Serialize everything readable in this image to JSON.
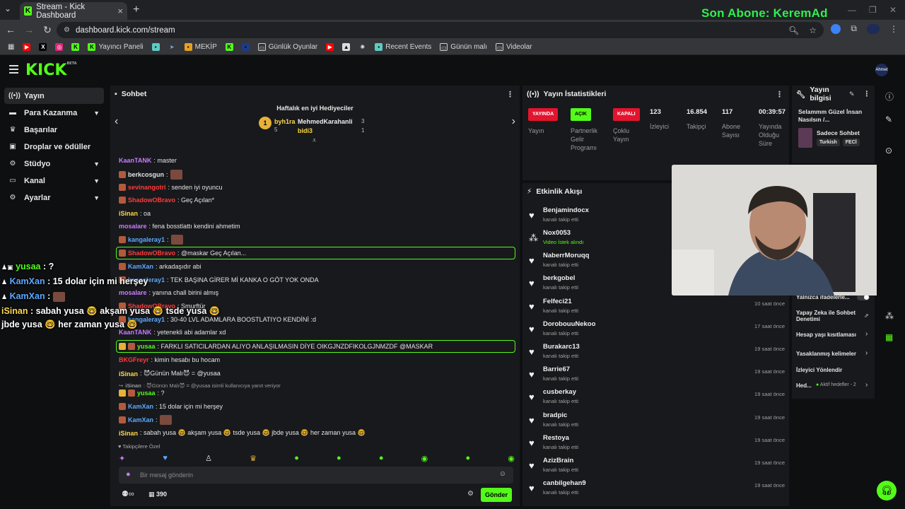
{
  "browser": {
    "tab_title": "Stream - Kick Dashboard",
    "url": "dashboard.kick.com/stream",
    "overlay_sub_label": "Son Abone: KeremAd",
    "bookmarks": [
      "Yayıncı Paneli",
      "MEKİP",
      "Günlük Oyunlar",
      "Recent Events",
      "Günün malı",
      "Videolar"
    ]
  },
  "app": {
    "logo": "KICK",
    "logo_badge": "BETA",
    "user_badge": "Ahmet"
  },
  "sidebar": {
    "items": [
      {
        "label": "Yayın",
        "icon": "broadcast-icon"
      },
      {
        "label": "Para Kazanma",
        "icon": "money-icon"
      },
      {
        "label": "Başarılar",
        "icon": "trophy-icon"
      },
      {
        "label": "Droplar ve ödüller",
        "icon": "gift-icon"
      },
      {
        "label": "Stüdyo",
        "icon": "gear-icon"
      },
      {
        "label": "Kanal",
        "icon": "tv-icon"
      },
      {
        "label": "Ayarlar",
        "icon": "settings-icon"
      }
    ]
  },
  "chat": {
    "title": "Sohbet",
    "gifters_title": "Haftalık en iyi Hediyeciler",
    "gifters": [
      {
        "name": "byh1ra",
        "count": "5"
      },
      {
        "name": "MehmedKarahanli",
        "count": "3"
      },
      {
        "name": "bidi3",
        "count": "1"
      }
    ],
    "messages": [
      {
        "user": "KaanTANK",
        "text": ": master",
        "color": "#c77dff"
      },
      {
        "user": "berkcosgun",
        "text": ":",
        "color": "#e6e6e6"
      },
      {
        "user": "sevinangotri",
        "text": ": senden iyi oyuncu",
        "color": "#ff3b3b"
      },
      {
        "user": "ShadowOBravo",
        "text": ": Geç Açılan*",
        "color": "#ff3b3b"
      },
      {
        "user": "iSinan",
        "text": ": oa",
        "color": "#ffd84a"
      },
      {
        "user": "mosalare",
        "text": ": fena bosstlattı kendini ahmetim",
        "color": "#c77dff"
      },
      {
        "user": "kangaleray1",
        "text": ":",
        "color": "#5aa9ff"
      },
      {
        "user": "ShadowOBravo",
        "text": ": @maskar Geç Açılan...",
        "color": "#ff3b3b"
      },
      {
        "user": "KamXan",
        "text": ": arkadaşıdır abi",
        "color": "#5aa9ff"
      },
      {
        "user": "kangaleray1",
        "text": ": TEK BAŞINA GİRER Mİ KANKA O GÖT YOK ONDA",
        "color": "#5aa9ff"
      },
      {
        "user": "mosalare",
        "text": ": yanına chall birini almış",
        "color": "#c77dff"
      },
      {
        "user": "ShadowOBravo",
        "text": ": Smurftür",
        "color": "#ff3b3b"
      },
      {
        "user": "kangaleray1",
        "text": ": 30-40 LVL ADAMLARA BOOSTLATIYO KENDİNİ :d",
        "color": "#5aa9ff"
      },
      {
        "user": "KaanTANK",
        "text": ": yetenekli abi adamlar xd",
        "color": "#c77dff"
      },
      {
        "user": "yusaa",
        "text": ": FARKLI SATICILARDAN ALIYO ANLAŞILMASIN DİYE OIKGJNZDFIKOLGJNMZDF @MASKAR",
        "color": "#53fc18"
      },
      {
        "user": "BKGFreyr",
        "text": ": kimin hesabı bu hocam",
        "color": "#ff3b3b"
      },
      {
        "user": "iSinan",
        "text": ": 😈Günün Malı😈 = @yusaa",
        "color": "#ffd84a"
      },
      {
        "user": "iSinan",
        "text": ": 😈Günün Malı😈 = @yusaa isimli kullanıcıya yanıt veriyor",
        "color": "#9a9a9a"
      },
      {
        "user": "yusaa",
        "text": ": ?",
        "color": "#53fc18"
      },
      {
        "user": "KamXan",
        "text": ": 15 dolar için mi herşey",
        "color": "#5aa9ff"
      },
      {
        "user": "KamXan",
        "text": ":",
        "color": "#5aa9ff"
      },
      {
        "user": "iSinan",
        "text": ": sabah yusa 🤓 akşam yusa 🤓 tsde yusa 🤓 jbde yusa 🤓 her zaman yusa 🤓",
        "color": "#ffd84a"
      }
    ],
    "followers_only": "Takipçilere Özel",
    "input_placeholder": "Bir mesaj gönderin",
    "points": "390",
    "send_label": "Gönder"
  },
  "overlay_chat": [
    {
      "user": "yusaa",
      "text": " : ?",
      "color": "#53fc18"
    },
    {
      "user": "KamXan",
      "text": " : 15 dolar için mi herşey",
      "color": "#5aa9ff"
    },
    {
      "user": "KamXan",
      "text": " :",
      "color": "#5aa9ff"
    },
    {
      "user": "iSinan",
      "text": " : sabah yusa 🤓 akşam yusa 🤓 tsde yusa 🤓",
      "color": "#ffd84a"
    },
    {
      "user": "",
      "text": "jbde yusa 🤓 her zaman yusa 🤓",
      "color": "#ffffff"
    }
  ],
  "stats": {
    "title": "Yayın İstatistikleri",
    "items": [
      {
        "tag": "YAYINDA",
        "label": "Yayın",
        "tagtype": "red"
      },
      {
        "tag": "AÇIK",
        "label": "Partnerlik Gelir Programı",
        "tagtype": "green"
      },
      {
        "tag": "KAPALI",
        "label": "Çoklu Yayın",
        "tagtype": "red"
      },
      {
        "value": "123",
        "label": "İzleyici"
      },
      {
        "value": "16.854",
        "label": "Takipçi"
      },
      {
        "value": "117",
        "label": "Abone Sayısı"
      },
      {
        "value": "00:39:57",
        "label": "Yayında Olduğu Süre"
      }
    ]
  },
  "stream_info": {
    "title": "Yayın bilgisi",
    "stream_title": "Selammm Güzel İnsan Nasılsın /...",
    "category": "Sadece Sohbet",
    "tags": [
      "Turkish",
      "FECİ"
    ]
  },
  "events": {
    "title": "Etkinlik Akışı",
    "items": [
      {
        "name": "Benjamindocx",
        "sub": "kanalı takip etti",
        "when": ""
      },
      {
        "name": "Nox0053",
        "sub": "Video İstek alındı",
        "when": ""
      },
      {
        "name": "NaberrMoruqq",
        "sub": "kanalı takip etti",
        "when": ""
      },
      {
        "name": "berkgobel",
        "sub": "kanalı takip etti",
        "when": ""
      },
      {
        "name": "Felfeci21",
        "sub": "kanalı takip etti",
        "when": "10 saat önce"
      },
      {
        "name": "DorobouuNekoo",
        "sub": "kanalı takip etti",
        "when": "17 saat önce"
      },
      {
        "name": "Burakarc13",
        "sub": "kanalı takip etti",
        "when": "19 saat önce"
      },
      {
        "name": "Barrie67",
        "sub": "kanalı takip etti",
        "when": "19 saat önce"
      },
      {
        "name": "cusberkay",
        "sub": "kanalı takip etti",
        "when": "19 saat önce"
      },
      {
        "name": "bradpic",
        "sub": "kanalı takip etti",
        "when": "19 saat önce"
      },
      {
        "name": "Restoya",
        "sub": "kanalı takip etti",
        "when": "19 saat önce"
      },
      {
        "name": "AzizBrain",
        "sub": "kanalı takip etti",
        "when": "19 saat önce"
      },
      {
        "name": "canbilgehan9",
        "sub": "kanalı takip etti",
        "when": "19 saat önce"
      }
    ]
  },
  "moderation": {
    "items": [
      "Yalnızca ifadelerle...",
      "Yapay Zeka ile Sohbet Denetimi",
      "Hesap yaşı kısıtlaması",
      "Yasaklanmış kelimeler",
      "İzleyici Yönlendir",
      "Hed...",
      "Aktif hedefler - 2"
    ]
  }
}
